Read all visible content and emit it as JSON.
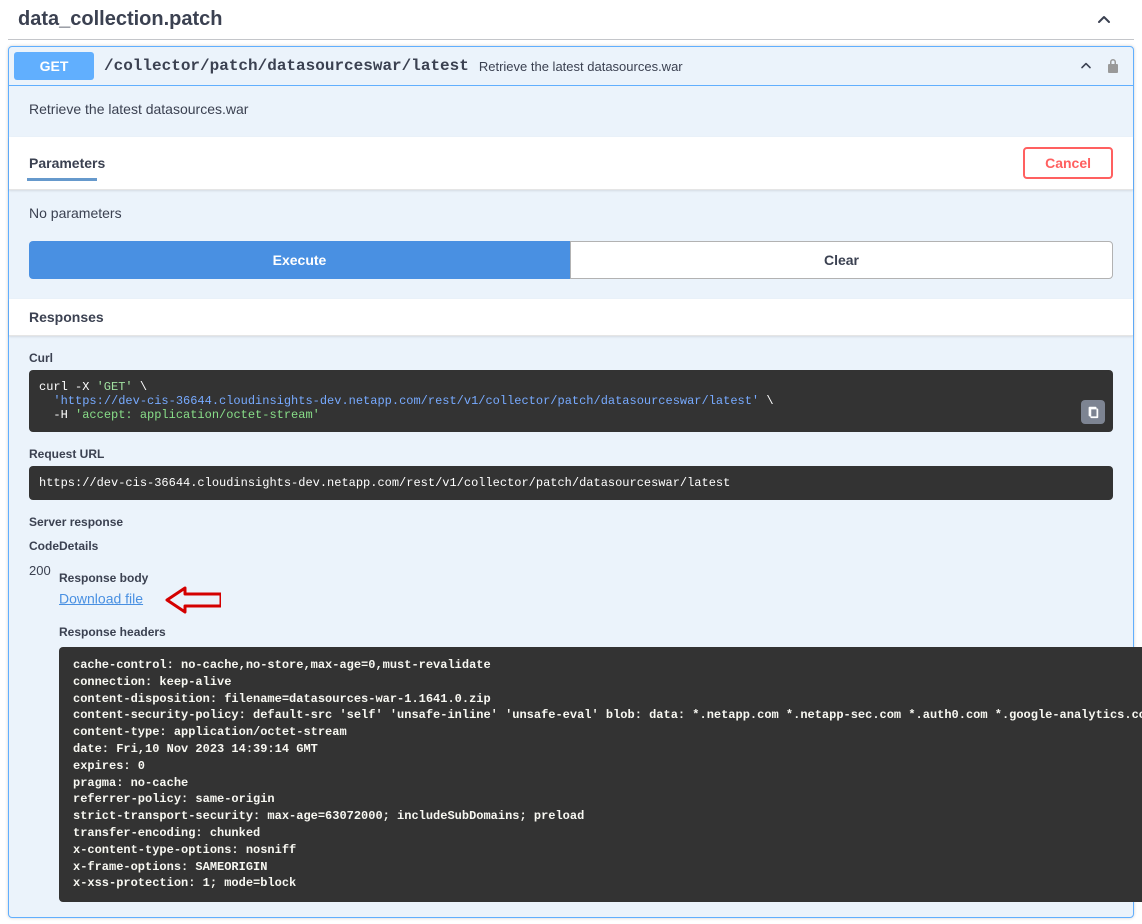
{
  "tag": {
    "title": "data_collection.patch"
  },
  "operation": {
    "method": "GET",
    "path": "/collector/patch/datasourceswar/latest",
    "summary": "Retrieve the latest datasources.war",
    "description": "Retrieve the latest datasources.war"
  },
  "parameters": {
    "heading": "Parameters",
    "cancel_label": "Cancel",
    "empty_text": "No parameters"
  },
  "actions": {
    "execute_label": "Execute",
    "clear_label": "Clear"
  },
  "responses": {
    "heading": "Responses",
    "curl_label": "Curl",
    "request_url_label": "Request URL",
    "server_response_label": "Server response",
    "code_header": "Code",
    "details_header": "Details",
    "response_body_label": "Response body",
    "download_link_text": "Download file",
    "response_headers_label": "Response headers",
    "status_code": "200",
    "curl": {
      "line_cmd": "curl -X ",
      "method_q": "'GET'",
      "backslash": " \\",
      "url_q": "'https://dev-cis-36644.cloudinsights-dev.netapp.com/rest/v1/collector/patch/datasourceswar/latest'",
      "hflag": "  -H ",
      "header_q": "'accept: application/octet-stream'"
    },
    "request_url": "https://dev-cis-36644.cloudinsights-dev.netapp.com/rest/v1/collector/patch/datasourceswar/latest",
    "headers": [
      {
        "name": "cache-control",
        "value": "no-cache,no-store,max-age=0,must-revalidate"
      },
      {
        "name": "connection",
        "value": "keep-alive"
      },
      {
        "name": "content-disposition",
        "value": "filename=datasources-war-1.1641.0.zip"
      },
      {
        "name": "content-security-policy",
        "value": "default-src 'self' 'unsafe-inline' 'unsafe-eval' blob: data: *.netapp.com *.netapp-sec.com *.auth0.com *.google-analytics.com storage.googleapis.com *.spotinst.com"
      },
      {
        "name": "content-type",
        "value": "application/octet-stream"
      },
      {
        "name": "date",
        "value": "Fri,10 Nov 2023 14:39:14 GMT"
      },
      {
        "name": "expires",
        "value": "0"
      },
      {
        "name": "pragma",
        "value": "no-cache"
      },
      {
        "name": "referrer-policy",
        "value": "same-origin"
      },
      {
        "name": "strict-transport-security",
        "value": "max-age=63072000; includeSubDomains; preload"
      },
      {
        "name": "transfer-encoding",
        "value": "chunked"
      },
      {
        "name": "x-content-type-options",
        "value": "nosniff"
      },
      {
        "name": "x-frame-options",
        "value": "SAMEORIGIN"
      },
      {
        "name": "x-xss-protection",
        "value": "1; mode=block"
      }
    ]
  }
}
